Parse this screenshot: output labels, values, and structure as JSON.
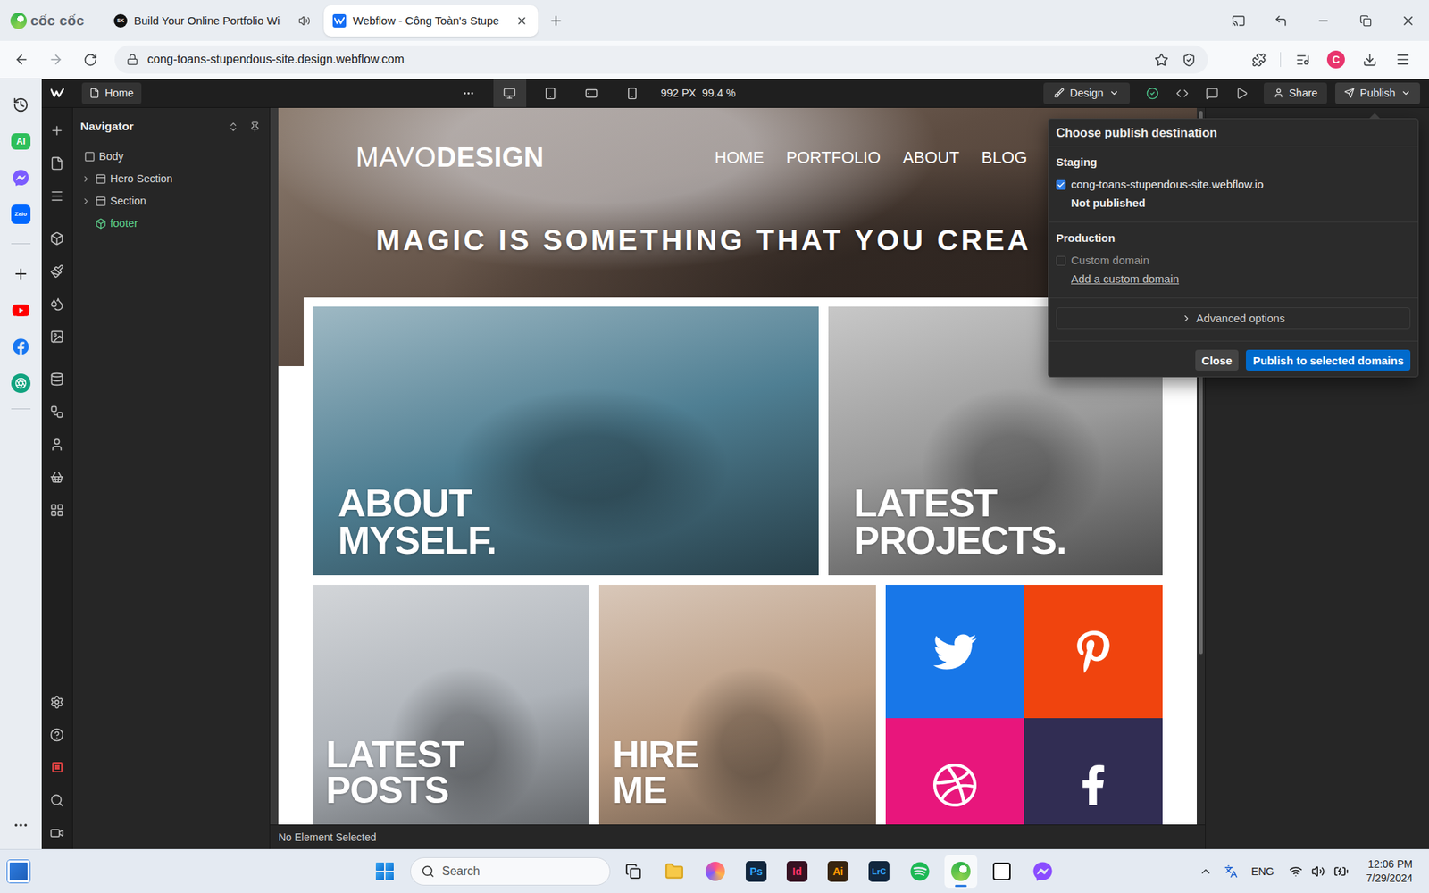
{
  "browser": {
    "brand": "cốc cốc",
    "tabs": [
      {
        "kind": "skillshare",
        "favicon": "SK",
        "label": "Build Your Online Portfolio Wi",
        "selected": false,
        "audio": true
      },
      {
        "kind": "webflow",
        "label": "Webflow - Công Toàn's Stupe",
        "selected": true,
        "audio": false
      }
    ],
    "url": "cong-toans-stupendous-site.design.webflow.com",
    "profile": "C",
    "sidebar": [
      {
        "kind": "history"
      },
      {
        "kind": "ai",
        "label": "AI"
      },
      {
        "kind": "messenger"
      },
      {
        "kind": "zalo",
        "label": "Zalo"
      },
      {
        "kind": "divider"
      },
      {
        "kind": "add"
      },
      {
        "kind": "youtube"
      },
      {
        "kind": "facebook"
      },
      {
        "kind": "chatgpt"
      },
      {
        "kind": "divider"
      }
    ]
  },
  "designer": {
    "page": "Home",
    "breakpoints": [
      {
        "kind": "desktop",
        "selected": true
      },
      {
        "kind": "tablet",
        "selected": false
      },
      {
        "kind": "landscape",
        "selected": false
      },
      {
        "kind": "portrait",
        "selected": false
      }
    ],
    "width": "992 PX",
    "zoom": "99.4 %",
    "mode": "Design",
    "saved": true,
    "share": "Share",
    "publish": "Publish",
    "publish_open": true
  },
  "navigator": {
    "title": "Navigator",
    "items": [
      {
        "label": "Body",
        "kind": "body",
        "depth": 0,
        "expandable": false
      },
      {
        "label": "Hero Section",
        "kind": "section",
        "depth": 1,
        "expandable": true
      },
      {
        "label": "Section",
        "kind": "section",
        "depth": 1,
        "expandable": true
      },
      {
        "label": "footer",
        "kind": "component",
        "depth": 1,
        "expandable": false
      }
    ]
  },
  "site": {
    "logo": {
      "light": "MAVO",
      "bold": "DESIGN"
    },
    "nav": [
      "HOME",
      "PORTFOLIO",
      "ABOUT",
      "BLOG"
    ],
    "headline": "MAGIC IS SOMETHING THAT YOU CREA",
    "feature_cards": [
      {
        "title": [
          "ABOUT",
          "MYSELF."
        ],
        "color": "#4f7f93"
      },
      {
        "title": [
          "LATEST",
          "PROJECTS."
        ],
        "color": "#9a9a9a"
      }
    ],
    "more_cards": [
      {
        "title": [
          "LATEST",
          "POSTS"
        ],
        "color": "#aeb3b9"
      },
      {
        "title": [
          "HIRE",
          "ME"
        ],
        "color": "#b99a80"
      }
    ],
    "social": [
      {
        "kind": "twitter",
        "color": "#1877e8"
      },
      {
        "kind": "pinterest",
        "color": "#f0440e"
      },
      {
        "kind": "dribbble",
        "color": "#e8167c"
      },
      {
        "kind": "facebook",
        "color": "#312d53"
      }
    ]
  },
  "publish_popup": {
    "title": "Choose publish destination",
    "sections": [
      {
        "label": "Staging",
        "options": [
          {
            "label": "cong-toans-stupendous-site.webflow.io",
            "checked": true,
            "disabled": false,
            "note": "Not published"
          }
        ]
      },
      {
        "label": "Production",
        "options": [
          {
            "label": "Custom domain",
            "checked": false,
            "disabled": true
          }
        ],
        "link": "Add a custom domain"
      }
    ],
    "advanced": "Advanced options",
    "advanced_expanded": false,
    "buttons": [
      {
        "label": "Close",
        "primary": false
      },
      {
        "label": "Publish to selected domains",
        "primary": true
      }
    ]
  },
  "status_bar": "No Element Selected",
  "taskbar": {
    "search": "Search",
    "apps": [
      {
        "kind": "task-view",
        "selected": false
      },
      {
        "kind": "explorer",
        "selected": false
      },
      {
        "kind": "creative",
        "selected": false
      },
      {
        "kind": "adobe",
        "label": "Ps",
        "color": "#31a8ff",
        "selected": false
      },
      {
        "kind": "adobe",
        "label": "Id",
        "color": "#ff3366",
        "selected": false
      },
      {
        "kind": "adobe",
        "label": "Ai",
        "color": "#ff9a00",
        "selected": false
      },
      {
        "kind": "adobe",
        "label": "LrC",
        "color": "#31a8ff",
        "selected": false
      },
      {
        "kind": "spotify",
        "selected": false
      },
      {
        "kind": "coccoc",
        "selected": true
      },
      {
        "kind": "notion",
        "selected": false
      },
      {
        "kind": "messenger",
        "selected": false
      }
    ],
    "language": "ENG",
    "time": "12:06 PM",
    "date": "7/29/2024"
  }
}
